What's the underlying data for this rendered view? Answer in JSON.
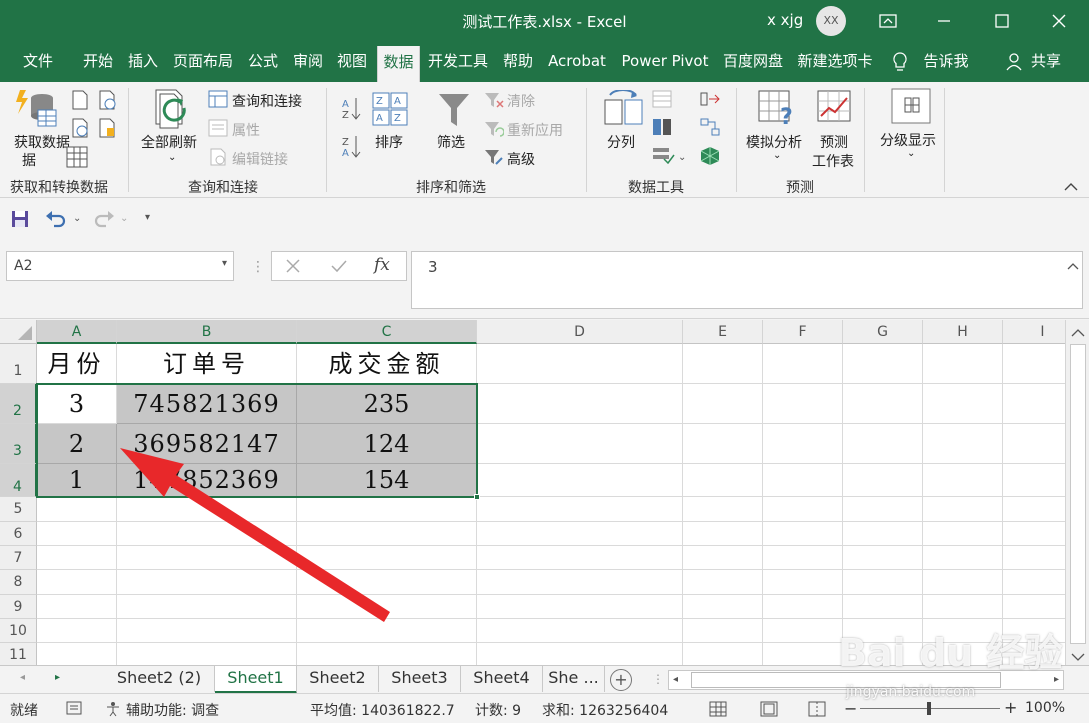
{
  "window": {
    "title": "测试工作表.xlsx  -  Excel",
    "user": "x xjg",
    "avatar": "XX"
  },
  "tabs": [
    "文件",
    "开始",
    "插入",
    "页面布局",
    "公式",
    "审阅",
    "视图",
    "数据",
    "开发工具",
    "帮助",
    "Acrobat",
    "Power Pivot",
    "百度网盘",
    "新建选项卡"
  ],
  "tell_me": "告诉我",
  "share": "共享",
  "ribbon": {
    "get_data": "获取数据",
    "get_data_2": "据",
    "group_get": "获取和转换数据",
    "refresh_all": "全部刷新",
    "query_connect": "查询和连接",
    "properties": "属性",
    "edit_links": "编辑链接",
    "group_query": "查询和连接",
    "sort": "排序",
    "filter": "筛选",
    "clear": "清除",
    "reapply": "重新应用",
    "advanced": "高级",
    "group_sort": "排序和筛选",
    "text_to_cols": "分列",
    "group_tools": "数据工具",
    "what_if": "模拟分析",
    "forecast_1": "预测",
    "forecast_2": "工作表",
    "group_forecast": "预测",
    "outline": "分级显示"
  },
  "formula_bar": {
    "name_box": "A2",
    "formula": "3"
  },
  "columns": [
    "A",
    "B",
    "C",
    "D",
    "E",
    "F",
    "G",
    "H",
    "I"
  ],
  "rows": [
    "1",
    "2",
    "3",
    "4",
    "5",
    "6",
    "7",
    "8",
    "9",
    "10",
    "11"
  ],
  "cells": {
    "header": [
      "月份",
      "订单号",
      "成交金额"
    ],
    "data": [
      [
        "3",
        "745821369",
        "235"
      ],
      [
        "2",
        "369582147",
        "124"
      ],
      [
        "1",
        "147852369",
        "154"
      ]
    ]
  },
  "sheets": [
    "Sheet2 (2)",
    "Sheet1",
    "Sheet2",
    "Sheet3",
    "Sheet4",
    "She ..."
  ],
  "active_sheet": "Sheet1",
  "status": {
    "ready": "就绪",
    "accessibility": "辅助功能: 调查",
    "average": "平均值: 140361822.7",
    "count": "计数: 9",
    "sum": "求和: 1263256404",
    "zoom": "100%"
  },
  "watermark": {
    "brand": "Bai du 经验",
    "url": "jingyan.baidu.com"
  },
  "colors": {
    "excel_green": "#217346",
    "arrow_red": "#e8282a",
    "selection_fill": "#c6c6c6"
  }
}
